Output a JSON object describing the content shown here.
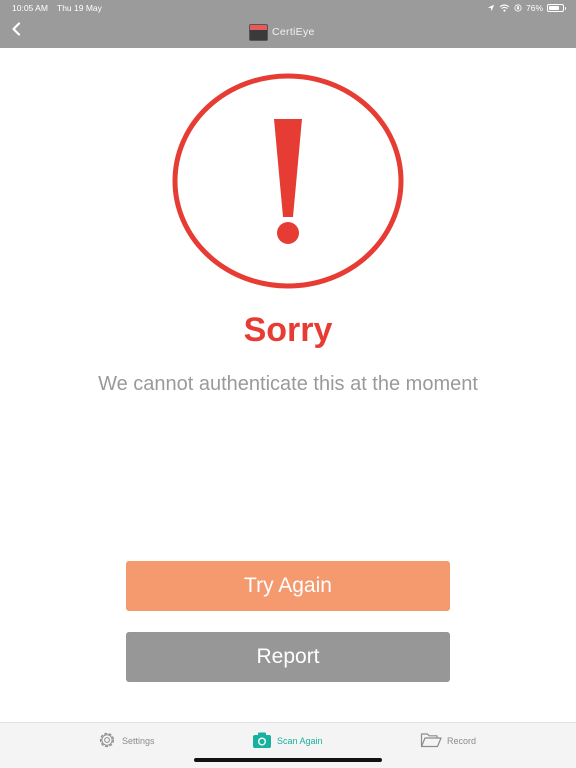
{
  "status_bar": {
    "time": "10:05 AM",
    "date": "Thu 19 May",
    "battery": "76%",
    "battery_level": 0.76
  },
  "header": {
    "back_icon": "chevron-left-icon",
    "app_name": "CertiEye"
  },
  "alert": {
    "icon": "exclamation-circle-icon",
    "title": "Sorry",
    "message": "We cannot authenticate this at the moment"
  },
  "actions": {
    "try_again": "Try Again",
    "report": "Report"
  },
  "tabs": [
    {
      "label": "Settings",
      "icon": "gear-icon",
      "active": false
    },
    {
      "label": "Scan Again",
      "icon": "camera-icon",
      "active": true
    },
    {
      "label": "Record",
      "icon": "folder-open-icon",
      "active": false
    }
  ],
  "colors": {
    "header_bg": "#9b9b9b",
    "alert_red": "#e63c33",
    "message_gray": "#9a9a9a",
    "try_again_bg": "#f59a6f",
    "report_bg": "#979797",
    "active_tab": "#17b19f",
    "inactive_tab": "#8c8c8c"
  }
}
